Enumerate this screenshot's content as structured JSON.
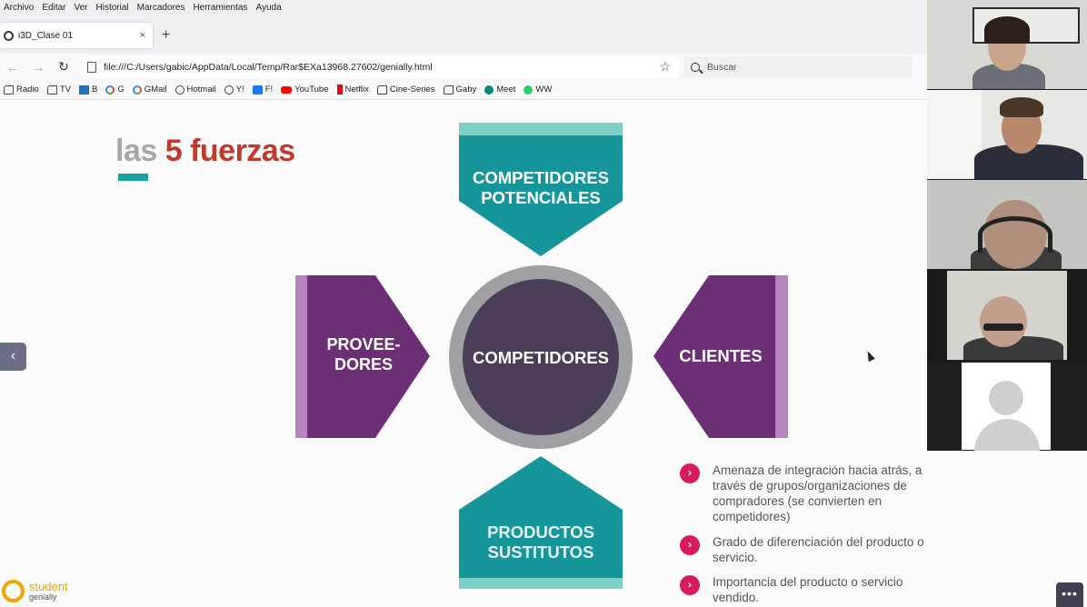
{
  "browser": {
    "menu": [
      "Archivo",
      "Editar",
      "Ver",
      "Historial",
      "Marcadores",
      "Herramientas",
      "Ayuda"
    ],
    "tab_title": "i3D_Clase 01",
    "tab_close": "×",
    "new_tab": "+",
    "url": "file:///C:/Users/gabic/AppData/Local/Temp/Rar$EXa13968.27602/genially.html",
    "search_placeholder": "Buscar",
    "bookmarks": [
      {
        "label": "Radio",
        "icon": "folder-icon"
      },
      {
        "label": "TV",
        "icon": "folder-icon"
      },
      {
        "label": "B",
        "icon": "bing-icon"
      },
      {
        "label": "G",
        "icon": "google-icon"
      },
      {
        "label": "GMail",
        "icon": "google-icon"
      },
      {
        "label": "Hotmail",
        "icon": "globe-icon"
      },
      {
        "label": "Y!",
        "icon": "globe-icon"
      },
      {
        "label": "F!",
        "icon": "facebook-icon"
      },
      {
        "label": "YouTube",
        "icon": "youtube-icon"
      },
      {
        "label": "Netflix",
        "icon": "netflix-icon"
      },
      {
        "label": "Cine-Series",
        "icon": "folder-icon"
      },
      {
        "label": "Gaby",
        "icon": "folder-icon"
      },
      {
        "label": "Meet",
        "icon": "meet-icon"
      },
      {
        "label": "WW",
        "icon": "whatsapp-icon"
      }
    ]
  },
  "slide": {
    "title_part1": "las",
    "title_part2": "5 fuerzas",
    "top_label": "COMPETIDORES POTENCIALES",
    "center_label": "COMPETIDORES",
    "left_label": "PROVEE-\nDORES",
    "right_label": "CLIENTES",
    "bottom_label": "PRODUCTOS SUSTITUTOS",
    "bullets": [
      "Amenaza de integración hacia atrás, a través de grupos/organizaciones de compradores (se convierten en competidores)",
      "Grado de diferenciación del producto o servicio.",
      "Importancia del producto o servicio vendido."
    ],
    "watermark_brand": "student",
    "watermark_sub": "genially"
  },
  "colors": {
    "teal": "#16969a",
    "teal_light": "#7ed0c6",
    "purple": "#6c2f75",
    "purple_light": "#b882bd",
    "circle_dark": "#4b3e59",
    "circle_ring": "#a0a0a4",
    "title_red": "#c0392b",
    "bullet_pink": "#d81b60"
  }
}
